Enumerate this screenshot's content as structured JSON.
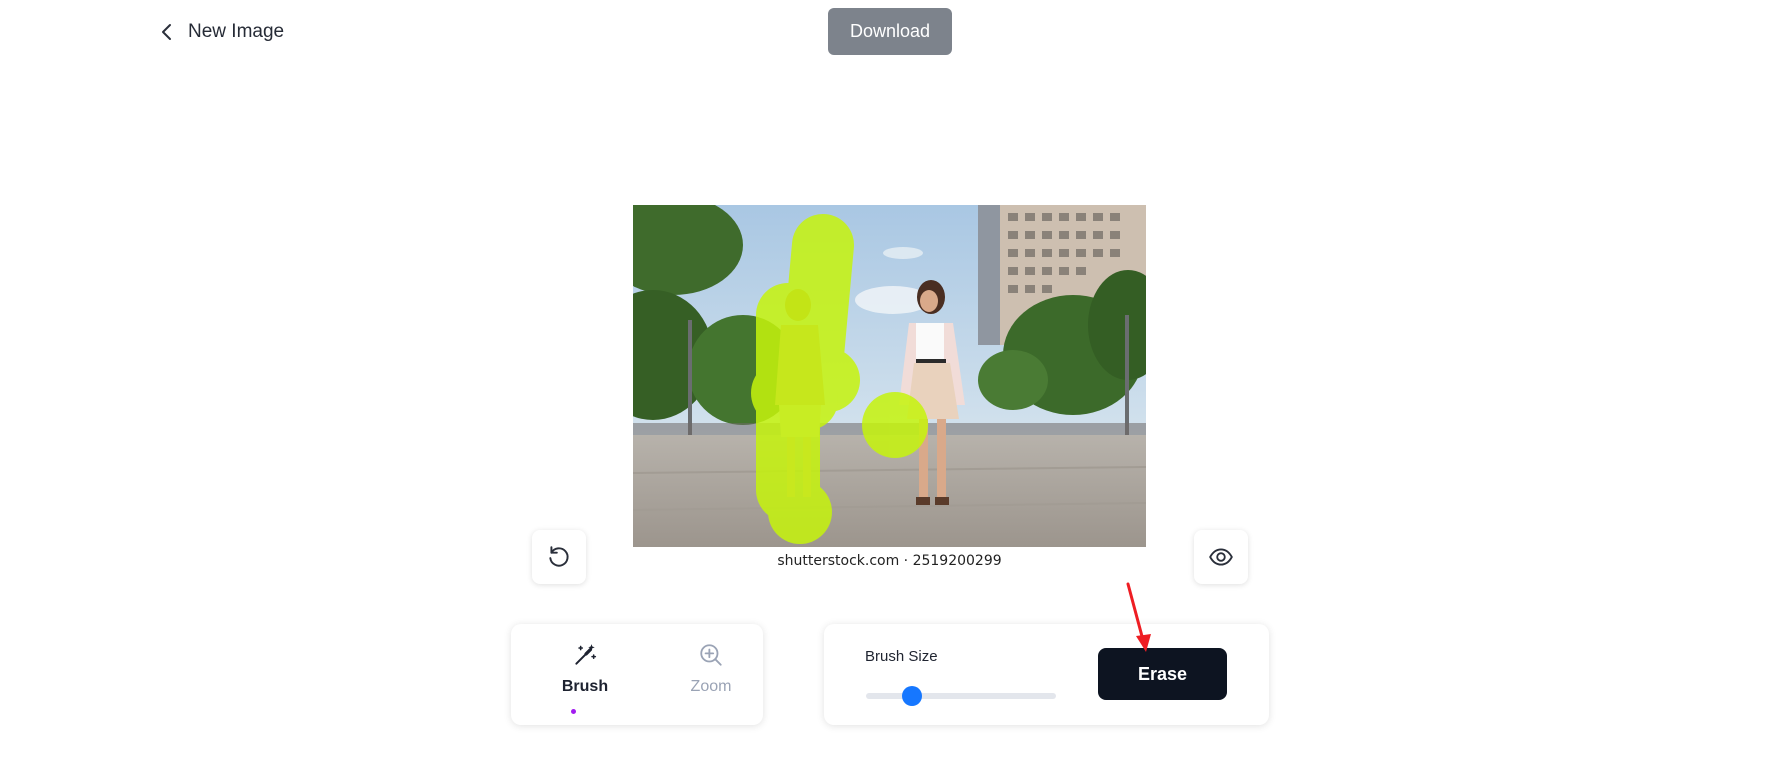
{
  "header": {
    "back_label": "New Image",
    "back_icon": "chevron-left-icon",
    "download_label": "Download"
  },
  "image": {
    "caption": "shutterstock.com · 2519200299",
    "mask_color": "#c6f40c"
  },
  "controls": {
    "reset_icon": "rotate-ccw-icon",
    "preview_icon": "eye-icon"
  },
  "tools": {
    "items": [
      {
        "label": "Brush",
        "icon": "magic-wand-icon",
        "active": true
      },
      {
        "label": "Zoom",
        "icon": "zoom-in-icon",
        "active": false
      }
    ],
    "active_indicator_color": "#a21cf0"
  },
  "brush": {
    "size_label": "Brush Size",
    "size_fraction": 0.24,
    "erase_label": "Erase"
  },
  "colors": {
    "download_bg": "#7d838c",
    "erase_bg": "#0d1421",
    "slider_thumb": "#1677ff",
    "annotation_arrow": "#ee1d23"
  }
}
